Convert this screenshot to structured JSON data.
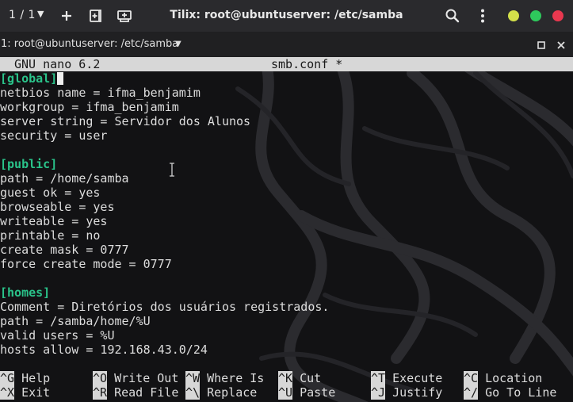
{
  "titlebar": {
    "session_label": "1 / 1",
    "title": "Tilix: root@ubuntuserver: /etc/samba",
    "colors": {
      "minimize": "#d3e04a",
      "maximize": "#2ec95c",
      "close": "#e8384f"
    }
  },
  "tab": {
    "title": "1: root@ubuntuserver: /etc/samba"
  },
  "nano": {
    "version": "GNU nano 6.2",
    "filename": "smb.conf *"
  },
  "editor": {
    "lines": [
      {
        "text": "[global]",
        "kind": "section"
      },
      {
        "text": "netbios name = ifma_benjamim",
        "kind": "text"
      },
      {
        "text": "workgroup = ifma_benjamim",
        "kind": "text"
      },
      {
        "text": "server string = Servidor dos Alunos",
        "kind": "text"
      },
      {
        "text": "security = user",
        "kind": "text"
      },
      {
        "text": "",
        "kind": "text"
      },
      {
        "text": "[public]",
        "kind": "section"
      },
      {
        "text": "path = /home/samba",
        "kind": "text"
      },
      {
        "text": "guest ok = yes",
        "kind": "text"
      },
      {
        "text": "browseable = yes",
        "kind": "text"
      },
      {
        "text": "writeable = yes",
        "kind": "text"
      },
      {
        "text": "printable = no",
        "kind": "text"
      },
      {
        "text": "create mask = 0777",
        "kind": "text"
      },
      {
        "text": "force create mode = 0777",
        "kind": "text"
      },
      {
        "text": "",
        "kind": "text"
      },
      {
        "text": "[homes]",
        "kind": "section"
      },
      {
        "text": "Comment = Diretórios dos usuários registrados.",
        "kind": "text"
      },
      {
        "text": "path = /samba/home/%U",
        "kind": "text"
      },
      {
        "text": "valid users = %U",
        "kind": "text"
      },
      {
        "text": "hosts allow = 192.168.43.0/24",
        "kind": "text"
      }
    ]
  },
  "shortcuts": [
    {
      "key": "^G",
      "label": "Help"
    },
    {
      "key": "^O",
      "label": "Write Out"
    },
    {
      "key": "^W",
      "label": "Where Is"
    },
    {
      "key": "^K",
      "label": "Cut"
    },
    {
      "key": "^T",
      "label": "Execute"
    },
    {
      "key": "^C",
      "label": "Location"
    },
    {
      "key": "^X",
      "label": "Exit"
    },
    {
      "key": "^R",
      "label": "Read File"
    },
    {
      "key": "^\\",
      "label": "Replace"
    },
    {
      "key": "^U",
      "label": "Paste"
    },
    {
      "key": "^J",
      "label": "Justify"
    },
    {
      "key": "^/",
      "label": "Go To Line"
    }
  ]
}
